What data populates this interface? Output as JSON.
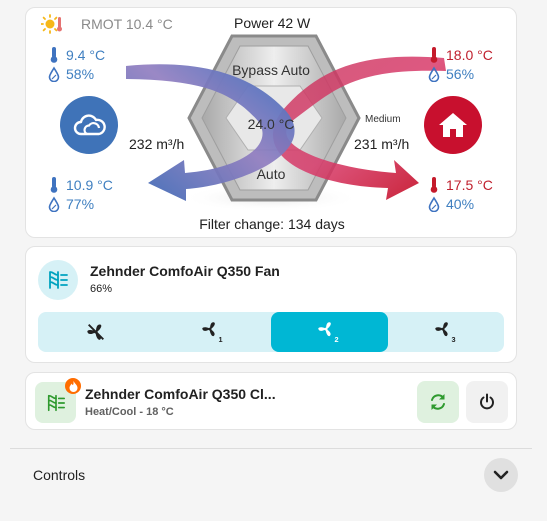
{
  "ventilation": {
    "outdoor_label": "RMOT 10.4 °C",
    "power": "Power 42 W",
    "outdoor_air": {
      "temperature": "9.4 °C",
      "humidity": "58%"
    },
    "exhaust_air": {
      "temperature": "10.9 °C",
      "humidity": "77%"
    },
    "extract_air": {
      "temperature": "18.0 °C",
      "humidity": "56%"
    },
    "supply_air": {
      "temperature": "17.5 °C",
      "humidity": "40%"
    },
    "bypass": "Bypass Auto",
    "unit_temperature": "24.0 °C",
    "mode": "Auto",
    "level": "Medium",
    "exhaust_flow": "232 m³/h",
    "supply_flow": "231 m³/h",
    "filter": "Filter change: 134 days",
    "colors": {
      "cold": "#3f73c0",
      "warm": "#c51a2b",
      "outdoor_circle": "#3f73b8",
      "home_circle": "#c8102e"
    }
  },
  "fan": {
    "title": "Zehnder ComfoAir Q350 Fan",
    "state": "66%",
    "speeds": [
      {
        "level": "",
        "active": false
      },
      {
        "level": "1",
        "active": false
      },
      {
        "level": "2",
        "active": true
      },
      {
        "level": "3",
        "active": false
      }
    ],
    "colors": {
      "accent": "#00b7d4",
      "track": "#d6f1f6"
    }
  },
  "climate": {
    "title": "Zehnder ComfoAir Q350 Cl...",
    "state": "Heat/Cool - 18 °C",
    "colors": {
      "accent": "#2e9a2e",
      "badge": "#ff6d00"
    }
  },
  "controls": {
    "label": "Controls"
  }
}
